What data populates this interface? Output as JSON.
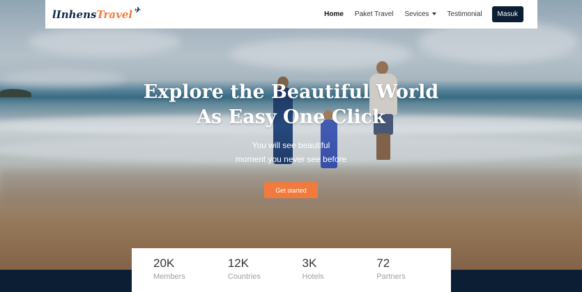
{
  "brand": {
    "name_part1": "lInhens",
    "name_part2": "Travel",
    "plane_icon": "airplane-icon"
  },
  "nav": {
    "items": [
      {
        "label": "Home",
        "active": true
      },
      {
        "label": "Paket Travel"
      },
      {
        "label": "Sevices",
        "has_dropdown": true
      },
      {
        "label": "Testimonial"
      }
    ],
    "login_label": "Masuk"
  },
  "hero": {
    "title_line1": "Explore the Beautiful World",
    "title_line2": "As Easy One Click",
    "subtitle_line1": "You will see beautiful",
    "subtitle_line2": "moment you never see before",
    "cta_label": "Get started"
  },
  "stats": [
    {
      "value": "20K",
      "label": "Members"
    },
    {
      "value": "12K",
      "label": "Countries"
    },
    {
      "value": "3K",
      "label": "Hotels"
    },
    {
      "value": "72",
      "label": "Partners"
    }
  ],
  "colors": {
    "navy": "#0b1e33",
    "accent": "#f27a3d",
    "white": "#ffffff"
  }
}
